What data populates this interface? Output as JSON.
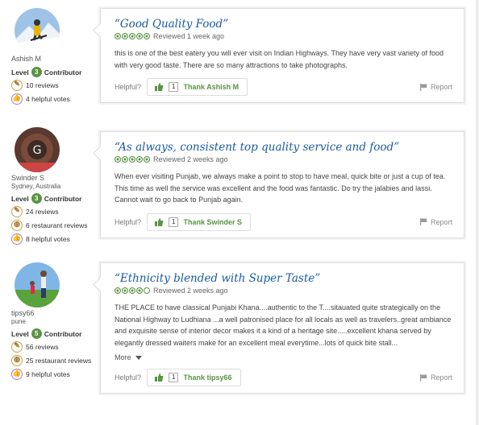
{
  "reviews": [
    {
      "user": {
        "name": "Ashish M",
        "location": "",
        "level_word": "Level",
        "level": "3",
        "level_suffix": "Contributor"
      },
      "stats": [
        {
          "icon": "reviews-badge-icon",
          "text": "10 reviews"
        },
        {
          "icon": "helpful-votes-badge-icon",
          "text": "4 helpful votes"
        }
      ],
      "title": "“Good Quality Food”",
      "rating": 5,
      "date": "Reviewed 1 week ago",
      "body": "this is one of the best eatery you will ever visit on Indian Highways. They have very vast variety of food with very good taste. There are so many attractions to take photographs.",
      "more": "",
      "helpful_label": "Helpful?",
      "thank_count": "1",
      "thank_label": "Thank Ashish M",
      "report_label": "Report"
    },
    {
      "user": {
        "name": "Swinder S",
        "location": "Sydney, Australia",
        "level_word": "Level",
        "level": "3",
        "level_suffix": "Contributor"
      },
      "stats": [
        {
          "icon": "reviews-badge-icon",
          "text": "24 reviews"
        },
        {
          "icon": "restaurant-reviews-badge-icon",
          "text": "6 restaurant reviews"
        },
        {
          "icon": "helpful-votes-badge-icon",
          "text": "8 helpful votes"
        }
      ],
      "title": "“As always, consistent top quality service and food”",
      "rating": 5,
      "date": "Reviewed 2 weeks ago",
      "body": "When ever visiting Punjab, we always make a point to stop to have meal, quick bite or just a cup of tea. This time as well the service was excellent and the food was fantastic. Do try the jalabies and lassi. Cannot wait to go back to Punjab again.",
      "more": "",
      "helpful_label": "Helpful?",
      "thank_count": "1",
      "thank_label": "Thank Swinder S",
      "report_label": "Report"
    },
    {
      "user": {
        "name": "tipsy66",
        "location": "pune",
        "level_word": "Level",
        "level": "5",
        "level_suffix": "Contributor"
      },
      "stats": [
        {
          "icon": "reviews-badge-icon",
          "text": "56 reviews"
        },
        {
          "icon": "restaurant-reviews-badge-icon",
          "text": "25 restaurant reviews"
        },
        {
          "icon": "helpful-votes-badge-icon",
          "text": "9 helpful votes"
        }
      ],
      "title": "“Ethnicity blended with Super Taste”",
      "rating": 4,
      "date": "Reviewed 2 weeks ago",
      "body": "THE PLACE to have classical Punjabi Khana....authentic to the T....sitauated quite strategically on the National Highway to Ludhiana ...a well patronised place for all locals as well as travelers..great ambiance and exquisite sense of interior decor makes it a kind of a heritage site.....excellent khana served by elegantly dressed waiters make for an excellent meal everytime...lots of quick bite stall...",
      "more": "More",
      "helpful_label": "Helpful?",
      "thank_count": "1",
      "thank_label": "Thank tipsy66",
      "report_label": "Report"
    }
  ],
  "colors": {
    "accent": "#589442",
    "title": "#1a5ba3"
  }
}
